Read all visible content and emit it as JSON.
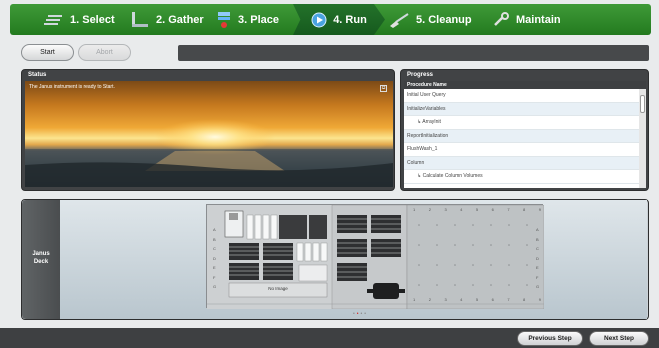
{
  "wizard": {
    "steps": [
      {
        "label": "1. Select",
        "icon": "rack-icon"
      },
      {
        "label": "2. Gather",
        "icon": "tips-icon"
      },
      {
        "label": "3. Place",
        "icon": "plate-place-icon"
      },
      {
        "label": "4. Run",
        "icon": "play-icon",
        "active": true
      },
      {
        "label": "5. Cleanup",
        "icon": "broom-icon"
      },
      {
        "label": "Maintain",
        "icon": "wrench-icon"
      }
    ]
  },
  "toolbar": {
    "start_label": "Start",
    "abort_label": "Abort",
    "message": ""
  },
  "status": {
    "title": "Status",
    "message": "The Janus instrument is ready to Start.",
    "expand_glyph": "⧉"
  },
  "progress": {
    "title": "Progress",
    "column_header": "Procedure Name",
    "rows": [
      {
        "name": "Initial User Query",
        "sub": false
      },
      {
        "name": "InitializeVariables",
        "sub": false
      },
      {
        "name": "↳ ArrayInit",
        "sub": true
      },
      {
        "name": "ReportInitialization",
        "sub": false
      },
      {
        "name": "FlushWash_1",
        "sub": false
      },
      {
        "name": "Column",
        "sub": false
      },
      {
        "name": "↳ Calculate Column Volumes",
        "sub": true
      }
    ]
  },
  "deck": {
    "label_line1": "Janus",
    "label_line2": "Deck",
    "no_image_label": "No Image",
    "col_numbers": [
      "1",
      "2",
      "3",
      "4",
      "5",
      "6",
      "7",
      "8",
      "9"
    ],
    "row_letters": [
      "A",
      "B",
      "C",
      "D",
      "E",
      "F",
      "G"
    ],
    "pager": [
      "•",
      "•",
      "•",
      "•"
    ]
  },
  "footer": {
    "previous_label": "Previous Step",
    "next_label": "Next Step"
  },
  "colors": {
    "nav_green": "#2e8a2a",
    "active_step": "#1d6824",
    "panel_dark": "#414345"
  }
}
